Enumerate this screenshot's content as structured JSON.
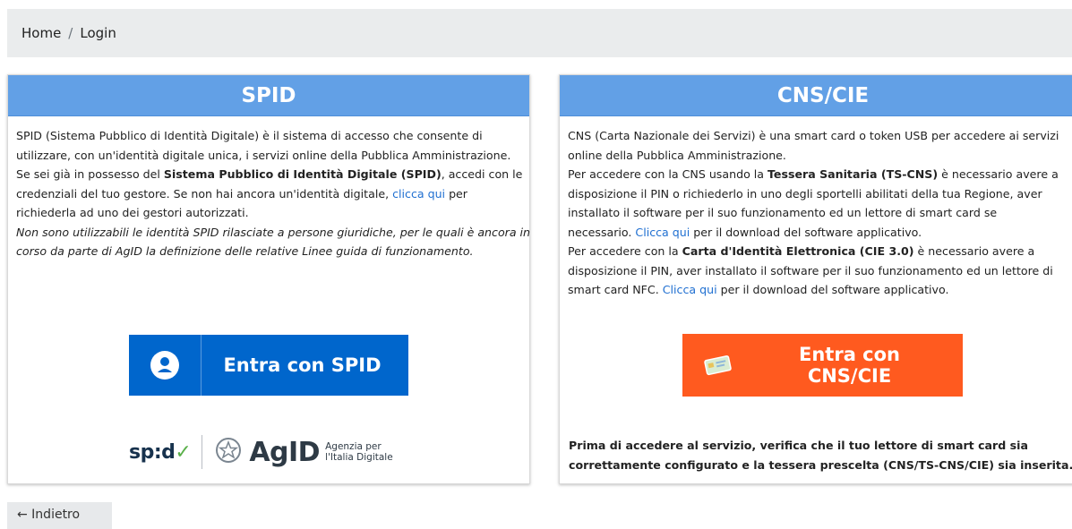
{
  "breadcrumb": {
    "home": "Home",
    "separator": "/",
    "current": "Login"
  },
  "spid": {
    "title": "SPID",
    "text": {
      "l1": "SPID (Sistema Pubblico di Identità Digitale) è il sistema di accesso che consente di",
      "l2": "utilizzare, con un'identità digitale unica, i servizi online della Pubblica Amministrazione.",
      "l3a": "Se sei già in possesso del ",
      "l3b": "Sistema Pubblico di Identità Digitale (SPID)",
      "l3c": ", accedi con le",
      "l4": "credenziali del tuo gestore. Se non hai ancora un'identità digitale, ",
      "l4link": "clicca qui",
      "l4c": " per",
      "l5": "richiederla ad uno dei gestori autorizzati.",
      "l6": "Non sono utilizzabili le identità SPID rilasciate a persone giuridiche, per le quali è ancora in",
      "l7": "corso da parte di AgID la definizione delle relative Linee guida di funzionamento."
    },
    "button_label": "Entra con SPID",
    "logo_spid": "sp:d",
    "logo_check": "✓",
    "logo_agid": "AgID",
    "logo_agid_sub1": "Agenzia per",
    "logo_agid_sub2": "l'Italia Digitale"
  },
  "cns": {
    "title": "CNS/CIE",
    "text": {
      "l1": "CNS (Carta Nazionale dei Servizi) è una smart card o token USB per accedere ai servizi",
      "l2": "online della Pubblica Amministrazione.",
      "l3a": "Per accedere con la CNS usando la ",
      "l3b": "Tessera Sanitaria (TS-CNS)",
      "l3c": " è necessario avere a",
      "l4": "disposizione il PIN o richiederlo in uno degli sportelli abilitati della tua Regione, aver",
      "l5": "installato il software per il suo funzionamento ed un lettore di smart card se",
      "l6a": "necessario. ",
      "l6link": "Clicca qui",
      "l6c": " per il download del software applicativo.",
      "l7a": "Per accedere con la ",
      "l7b": "Carta d'Identità Elettronica (CIE 3.0)",
      "l7c": " è necessario avere a",
      "l8": "disposizione il PIN, aver installato il software per il suo funzionamento ed un lettore di",
      "l9a": "smart card NFC. ",
      "l9link": "Clicca qui",
      "l9c": " per il download del software applicativo."
    },
    "button_label": "Entra con CNS/CIE",
    "note_l1": "Prima di accedere al servizio, verifica che il tuo lettore di smart card sia",
    "note_l2": "correttamente configurato e la tessera prescelta (CNS/TS-CNS/CIE) sia inserita."
  },
  "back_button": "← Indietro",
  "colors": {
    "header_blue": "#62a0e6",
    "spid_blue": "#0066cc",
    "cns_orange": "#ff5a1f",
    "link": "#1f6fd1"
  }
}
